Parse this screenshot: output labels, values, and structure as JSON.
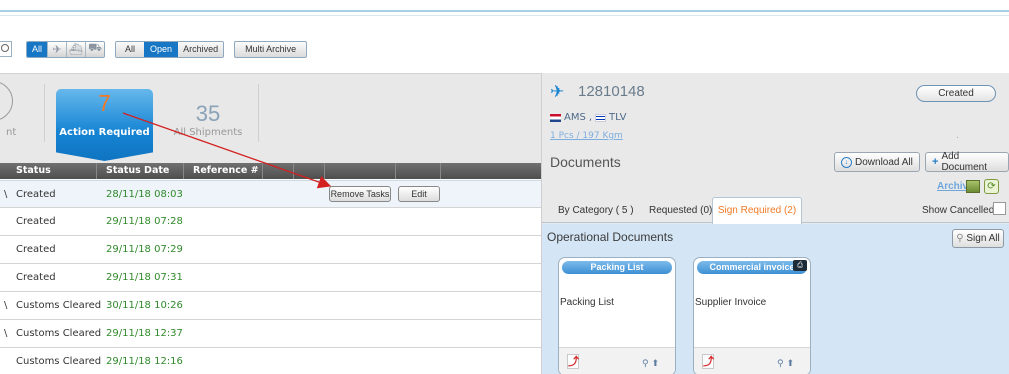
{
  "toolbar": {
    "mode_all": "All",
    "filter_all": "All",
    "filter_open": "Open",
    "filter_archived": "Archived",
    "multi_archive": "Multi Archive"
  },
  "summary": {
    "action_required_count": "7",
    "action_required_label": "Action Required",
    "all_shipments_count": "35",
    "all_shipments_label": "All Shipments",
    "stub_label": "nt"
  },
  "table": {
    "headers": [
      "Status",
      "Status Date",
      "Reference #"
    ],
    "rows": [
      {
        "chev": "\\",
        "status": "Created",
        "date": "28/11/18 08:03"
      },
      {
        "chev": "",
        "status": "Created",
        "date": "29/11/18 07:28"
      },
      {
        "chev": "",
        "status": "Created",
        "date": "29/11/18 07:29"
      },
      {
        "chev": "",
        "status": "Created",
        "date": "29/11/18 07:31"
      },
      {
        "chev": "\\",
        "status": "Customs Cleared",
        "date": "30/11/18 10:26"
      },
      {
        "chev": "\\",
        "status": "Customs Cleared",
        "date": "29/11/18 12:37"
      },
      {
        "chev": "",
        "status": "Customs Cleared",
        "date": "29/11/18 12:16"
      }
    ],
    "remove_tasks": "Remove Tasks",
    "edit": "Edit"
  },
  "shipment": {
    "id": "12810148",
    "status_badge": "Created",
    "origin": "AMS",
    "destination": "TLV",
    "pieces_weight": "1 Pcs / 197 Kgm",
    "side_dot": "."
  },
  "documents": {
    "title": "Documents",
    "download_all": "Download All",
    "add_document": "Add Document",
    "archive": "Archive",
    "tabs": {
      "by_category": "By Category ( 5 )",
      "requested": "Requested (0)",
      "sign_required": "Sign Required (2)"
    },
    "show_cancelled": "Show Cancelled",
    "section_title": "Operational Documents",
    "sign_all": "Sign All",
    "cards": [
      {
        "header": "Packing List",
        "body": "Packing List"
      },
      {
        "header": "Commercial invoice",
        "body": "Supplier Invoice"
      }
    ]
  },
  "colors": {
    "accent_blue": "#1777c5",
    "orange_count": "#f07a26",
    "date_green": "#2f8a2a",
    "arrow_red": "#d32020"
  }
}
